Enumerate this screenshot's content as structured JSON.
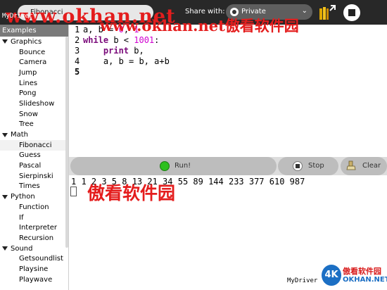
{
  "toolbar": {
    "activity_title": "Fibonacci",
    "share_label": "Share with:",
    "share_value": "Private",
    "keep_icon": "keep-icon",
    "stop_activity_icon": "stop-icon"
  },
  "watermarks": {
    "top_url": "www.okhan.net",
    "top_overlay": "www.okhan.net傲看软件园",
    "middle": "傲看软件园",
    "mydriver_top": "MyDriver",
    "mydriver_bottom": "MyDriver",
    "logo_4k": "4K",
    "logo_cn": "傲看软件园",
    "logo_en": "OKHAN.NET"
  },
  "sidebar": {
    "header": "Examples",
    "categories": [
      {
        "label": "Graphics",
        "items": [
          "Bounce",
          "Camera",
          "Jump",
          "Lines",
          "Pong",
          "Slideshow",
          "Snow",
          "Tree"
        ]
      },
      {
        "label": "Math",
        "items": [
          "Fibonacci",
          "Guess",
          "Pascal",
          "Sierpinski",
          "Times"
        ]
      },
      {
        "label": "Python",
        "items": [
          "Function",
          "If",
          "Interpreter",
          "Recursion"
        ]
      },
      {
        "label": "Sound",
        "items": [
          "Getsoundlist",
          "Playsine",
          "Playwave"
        ]
      }
    ],
    "selected": "Fibonacci"
  },
  "editor": {
    "line_numbers": [
      "1",
      "2",
      "3",
      "4",
      "5"
    ],
    "lines": [
      "a, b = 0, 1",
      "while b < 1001:",
      "    print b,",
      "    a, b = b, a+b",
      ""
    ]
  },
  "buttons": {
    "run": "Run!",
    "stop": "Stop",
    "clear": "Clear"
  },
  "console": {
    "output": "1 1 2 3 5 8 13 21 34 55 89 144 233 377 610 987"
  },
  "colors": {
    "toolbar_bg": "#282828",
    "watermark_red": "#e41d1d",
    "run_green": "#2ec01f",
    "number_magenta": "#d000d0"
  }
}
